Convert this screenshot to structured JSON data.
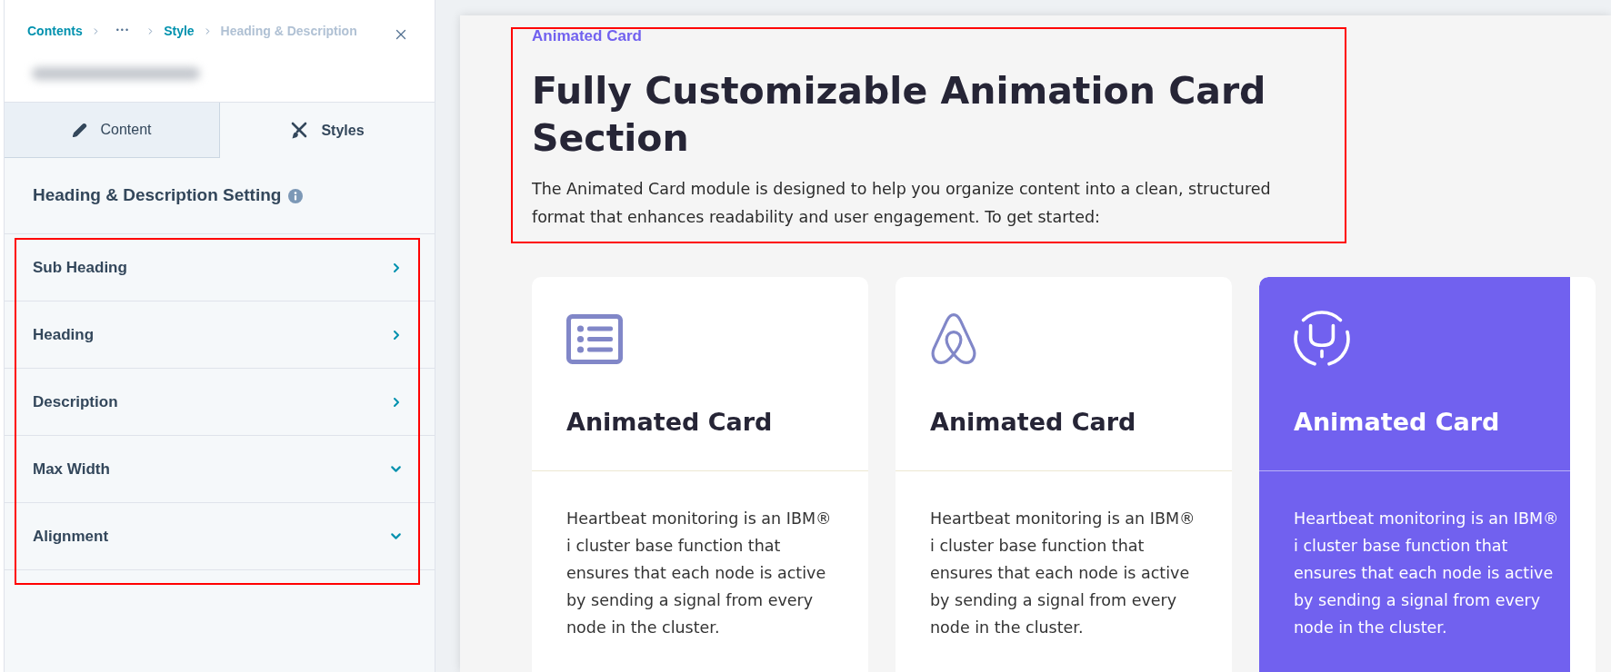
{
  "panel": {
    "breadcrumbs": [
      {
        "label": "Contents",
        "kind": "link",
        "current": false
      },
      {
        "label": "•••",
        "kind": "more",
        "current": false
      },
      {
        "label": "Style",
        "kind": "link",
        "current": false
      },
      {
        "label": "Heading & Description",
        "kind": "link",
        "current": true
      }
    ],
    "tabs": [
      {
        "label": "Content",
        "selected": false
      },
      {
        "label": "Styles",
        "selected": true
      }
    ],
    "section": {
      "title": "Heading & Description Setting",
      "highlighted": true,
      "items": [
        {
          "label": "Sub Heading",
          "kind": "link"
        },
        {
          "label": "Heading",
          "kind": "link"
        },
        {
          "label": "Description",
          "kind": "link"
        },
        {
          "label": "Max Width",
          "kind": "collapsible"
        },
        {
          "label": "Alignment",
          "kind": "collapsible"
        }
      ]
    }
  },
  "preview": {
    "intro": {
      "highlighted": true,
      "eyebrow": "Animated Card",
      "heading": "Fully Customizable Animation Card Section",
      "description": "The Animated Card module is designed to help you organize content into a clean, structured format that enhances readability and user engagement. To get started:"
    },
    "cards": [
      {
        "title": "Animated Card",
        "text": "Heartbeat monitoring is an IBM® i cluster base function that ensures that each node is active by sending a signal from every node in the cluster.",
        "hovered": false
      },
      {
        "title": "Animated Card",
        "text": "Heartbeat monitoring is an IBM® i cluster base function that ensures that each node is active by sending a signal from every node in the cluster.",
        "hovered": false
      },
      {
        "title": "Animated Card",
        "text": "Heartbeat monitoring is an IBM® i cluster base function that ensures that each node is active by sending a signal from every node in the cluster.",
        "hovered": true
      }
    ]
  }
}
